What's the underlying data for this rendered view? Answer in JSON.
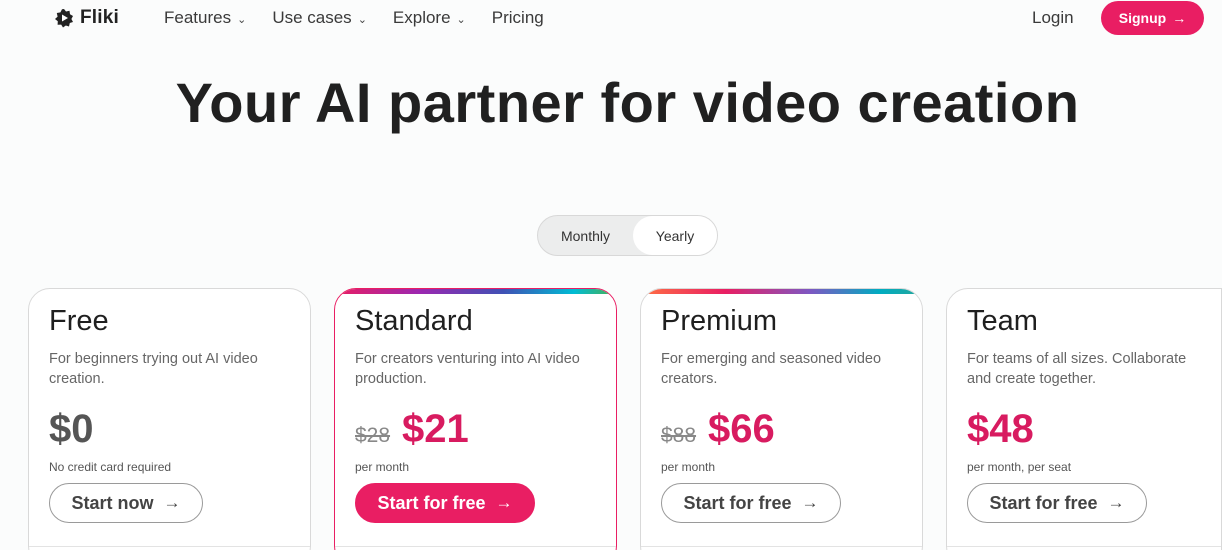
{
  "nav": {
    "brand": "Fliki",
    "links": [
      {
        "label": "Features",
        "has_dropdown": true
      },
      {
        "label": "Use cases",
        "has_dropdown": true
      },
      {
        "label": "Explore",
        "has_dropdown": true
      },
      {
        "label": "Pricing",
        "has_dropdown": false
      }
    ],
    "login_label": "Login",
    "signup_label": "Signup",
    "chevron_icon": "chevron-down-icon",
    "arrow_icon": "arrow-right-icon"
  },
  "hero": {
    "title": "Your AI partner for video creation"
  },
  "billing_toggle": {
    "monthly_label": "Monthly",
    "yearly_label": "Yearly",
    "selected": "Yearly"
  },
  "plans": [
    {
      "name": "Free",
      "description": "For beginners trying out AI video creation.",
      "old_price": "",
      "price": "$0",
      "price_note": "No credit card required",
      "cta": "Start now"
    },
    {
      "name": "Standard",
      "description": "For creators venturing into AI video production.",
      "old_price": "$28",
      "price": "$21",
      "price_note": "per month",
      "cta": "Start for free"
    },
    {
      "name": "Premium",
      "description": "For emerging and seasoned video creators.",
      "old_price": "$88",
      "price": "$66",
      "price_note": "per month",
      "cta": "Start for free"
    },
    {
      "name": "Team",
      "description": "For teams of all sizes. Collaborate and create together.",
      "old_price": "",
      "price": "$48",
      "price_note": "per month, per seat",
      "cta": "Start for free"
    }
  ],
  "colors": {
    "brand": "#e91e63",
    "price": "#d81b60",
    "background": "#fbfcfc"
  }
}
